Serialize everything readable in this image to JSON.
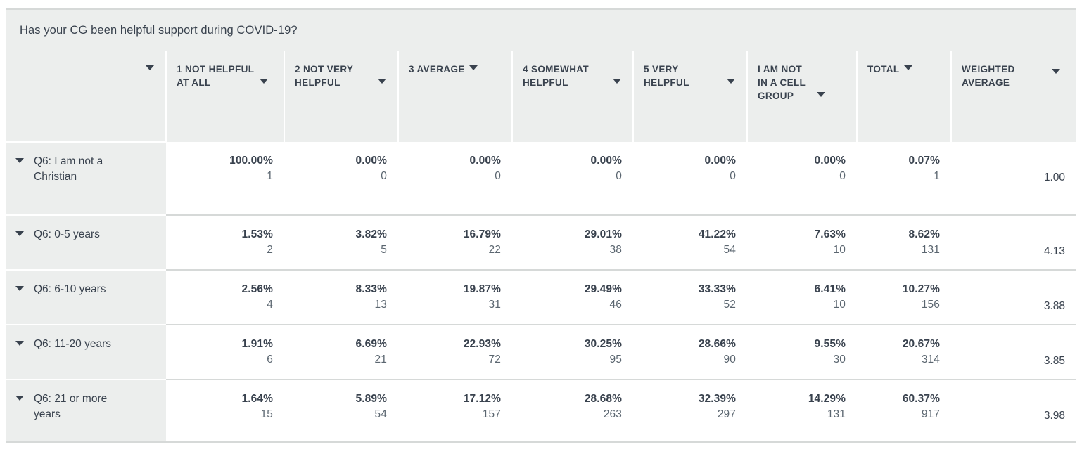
{
  "question": "Has your CG been helpful support during COVID-19?",
  "icons": {
    "sort_caret": "caret-down-icon",
    "expand_caret": "caret-down-icon"
  },
  "colors": {
    "header_bg": "#eceeed",
    "body_bg": "#ffffff",
    "text": "#39424e",
    "border": "#d6d9d8",
    "count_text": "#5b6670"
  },
  "columns": [
    {
      "key": "rowlabel",
      "label": "",
      "has_sort": true
    },
    {
      "key": "c1",
      "label": "1 NOT HELPFUL AT ALL",
      "has_sort": true
    },
    {
      "key": "c2",
      "label": "2 NOT VERY HELPFUL",
      "has_sort": true
    },
    {
      "key": "c3",
      "label": "3 AVERAGE",
      "has_sort": true
    },
    {
      "key": "c4",
      "label": "4 SOMEWHAT HELPFUL",
      "has_sort": true
    },
    {
      "key": "c5",
      "label": "5 VERY HELPFUL",
      "has_sort": true
    },
    {
      "key": "c6",
      "label": "I AM NOT IN A CELL GROUP",
      "has_sort": true
    },
    {
      "key": "total",
      "label": "TOTAL",
      "has_sort": true
    },
    {
      "key": "wavg",
      "label": "WEIGHTED AVERAGE",
      "has_sort": true
    }
  ],
  "column_labels": {
    "blank": "",
    "c1": "1 NOT HELPFUL AT ALL",
    "c2": "2 NOT VERY HELPFUL",
    "c3": "3 AVERAGE",
    "c4": "4 SOMEWHAT HELPFUL",
    "c5": "5 VERY HELPFUL",
    "c6": "I AM NOT IN A CELL GROUP",
    "total": "TOTAL",
    "wavg": "WEIGHTED AVERAGE"
  },
  "rows": [
    {
      "label": "Q6: I am not a Christian",
      "c1": {
        "pct": "100.00%",
        "count": "1"
      },
      "c2": {
        "pct": "0.00%",
        "count": "0"
      },
      "c3": {
        "pct": "0.00%",
        "count": "0"
      },
      "c4": {
        "pct": "0.00%",
        "count": "0"
      },
      "c5": {
        "pct": "0.00%",
        "count": "0"
      },
      "c6": {
        "pct": "0.00%",
        "count": "0"
      },
      "total": {
        "pct": "0.07%",
        "count": "1"
      },
      "wavg": "1.00"
    },
    {
      "label": "Q6: 0-5 years",
      "c1": {
        "pct": "1.53%",
        "count": "2"
      },
      "c2": {
        "pct": "3.82%",
        "count": "5"
      },
      "c3": {
        "pct": "16.79%",
        "count": "22"
      },
      "c4": {
        "pct": "29.01%",
        "count": "38"
      },
      "c5": {
        "pct": "41.22%",
        "count": "54"
      },
      "c6": {
        "pct": "7.63%",
        "count": "10"
      },
      "total": {
        "pct": "8.62%",
        "count": "131"
      },
      "wavg": "4.13"
    },
    {
      "label": "Q6: 6-10 years",
      "c1": {
        "pct": "2.56%",
        "count": "4"
      },
      "c2": {
        "pct": "8.33%",
        "count": "13"
      },
      "c3": {
        "pct": "19.87%",
        "count": "31"
      },
      "c4": {
        "pct": "29.49%",
        "count": "46"
      },
      "c5": {
        "pct": "33.33%",
        "count": "52"
      },
      "c6": {
        "pct": "6.41%",
        "count": "10"
      },
      "total": {
        "pct": "10.27%",
        "count": "156"
      },
      "wavg": "3.88"
    },
    {
      "label": "Q6: 11-20 years",
      "c1": {
        "pct": "1.91%",
        "count": "6"
      },
      "c2": {
        "pct": "6.69%",
        "count": "21"
      },
      "c3": {
        "pct": "22.93%",
        "count": "72"
      },
      "c4": {
        "pct": "30.25%",
        "count": "95"
      },
      "c5": {
        "pct": "28.66%",
        "count": "90"
      },
      "c6": {
        "pct": "9.55%",
        "count": "30"
      },
      "total": {
        "pct": "20.67%",
        "count": "314"
      },
      "wavg": "3.85"
    },
    {
      "label": "Q6: 21 or more years",
      "c1": {
        "pct": "1.64%",
        "count": "15"
      },
      "c2": {
        "pct": "5.89%",
        "count": "54"
      },
      "c3": {
        "pct": "17.12%",
        "count": "157"
      },
      "c4": {
        "pct": "28.68%",
        "count": "263"
      },
      "c5": {
        "pct": "32.39%",
        "count": "297"
      },
      "c6": {
        "pct": "14.29%",
        "count": "131"
      },
      "total": {
        "pct": "60.37%",
        "count": "917"
      },
      "wavg": "3.98"
    }
  ],
  "chart_data": {
    "type": "table",
    "title": "Has your CG been helpful support during COVID-19?",
    "categories": [
      "1 NOT HELPFUL AT ALL",
      "2 NOT VERY HELPFUL",
      "3 AVERAGE",
      "4 SOMEWHAT HELPFUL",
      "5 VERY HELPFUL",
      "I AM NOT IN A CELL GROUP"
    ],
    "series": [
      {
        "name": "Q6: I am not a Christian",
        "percents": [
          100.0,
          0.0,
          0.0,
          0.0,
          0.0,
          0.0
        ],
        "counts": [
          1,
          0,
          0,
          0,
          0,
          0
        ],
        "total_pct": 0.07,
        "total_count": 1,
        "weighted_average": 1.0
      },
      {
        "name": "Q6: 0-5 years",
        "percents": [
          1.53,
          3.82,
          16.79,
          29.01,
          41.22,
          7.63
        ],
        "counts": [
          2,
          5,
          22,
          38,
          54,
          10
        ],
        "total_pct": 8.62,
        "total_count": 131,
        "weighted_average": 4.13
      },
      {
        "name": "Q6: 6-10 years",
        "percents": [
          2.56,
          8.33,
          19.87,
          29.49,
          33.33,
          6.41
        ],
        "counts": [
          4,
          13,
          31,
          46,
          52,
          10
        ],
        "total_pct": 10.27,
        "total_count": 156,
        "weighted_average": 3.88
      },
      {
        "name": "Q6: 11-20 years",
        "percents": [
          1.91,
          6.69,
          22.93,
          30.25,
          28.66,
          9.55
        ],
        "counts": [
          6,
          21,
          72,
          95,
          90,
          30
        ],
        "total_pct": 20.67,
        "total_count": 314,
        "weighted_average": 3.85
      },
      {
        "name": "Q6: 21 or more years",
        "percents": [
          1.64,
          5.89,
          17.12,
          28.68,
          32.39,
          14.29
        ],
        "counts": [
          15,
          54,
          157,
          263,
          297,
          131
        ],
        "total_pct": 60.37,
        "total_count": 917,
        "weighted_average": 3.98
      }
    ]
  }
}
